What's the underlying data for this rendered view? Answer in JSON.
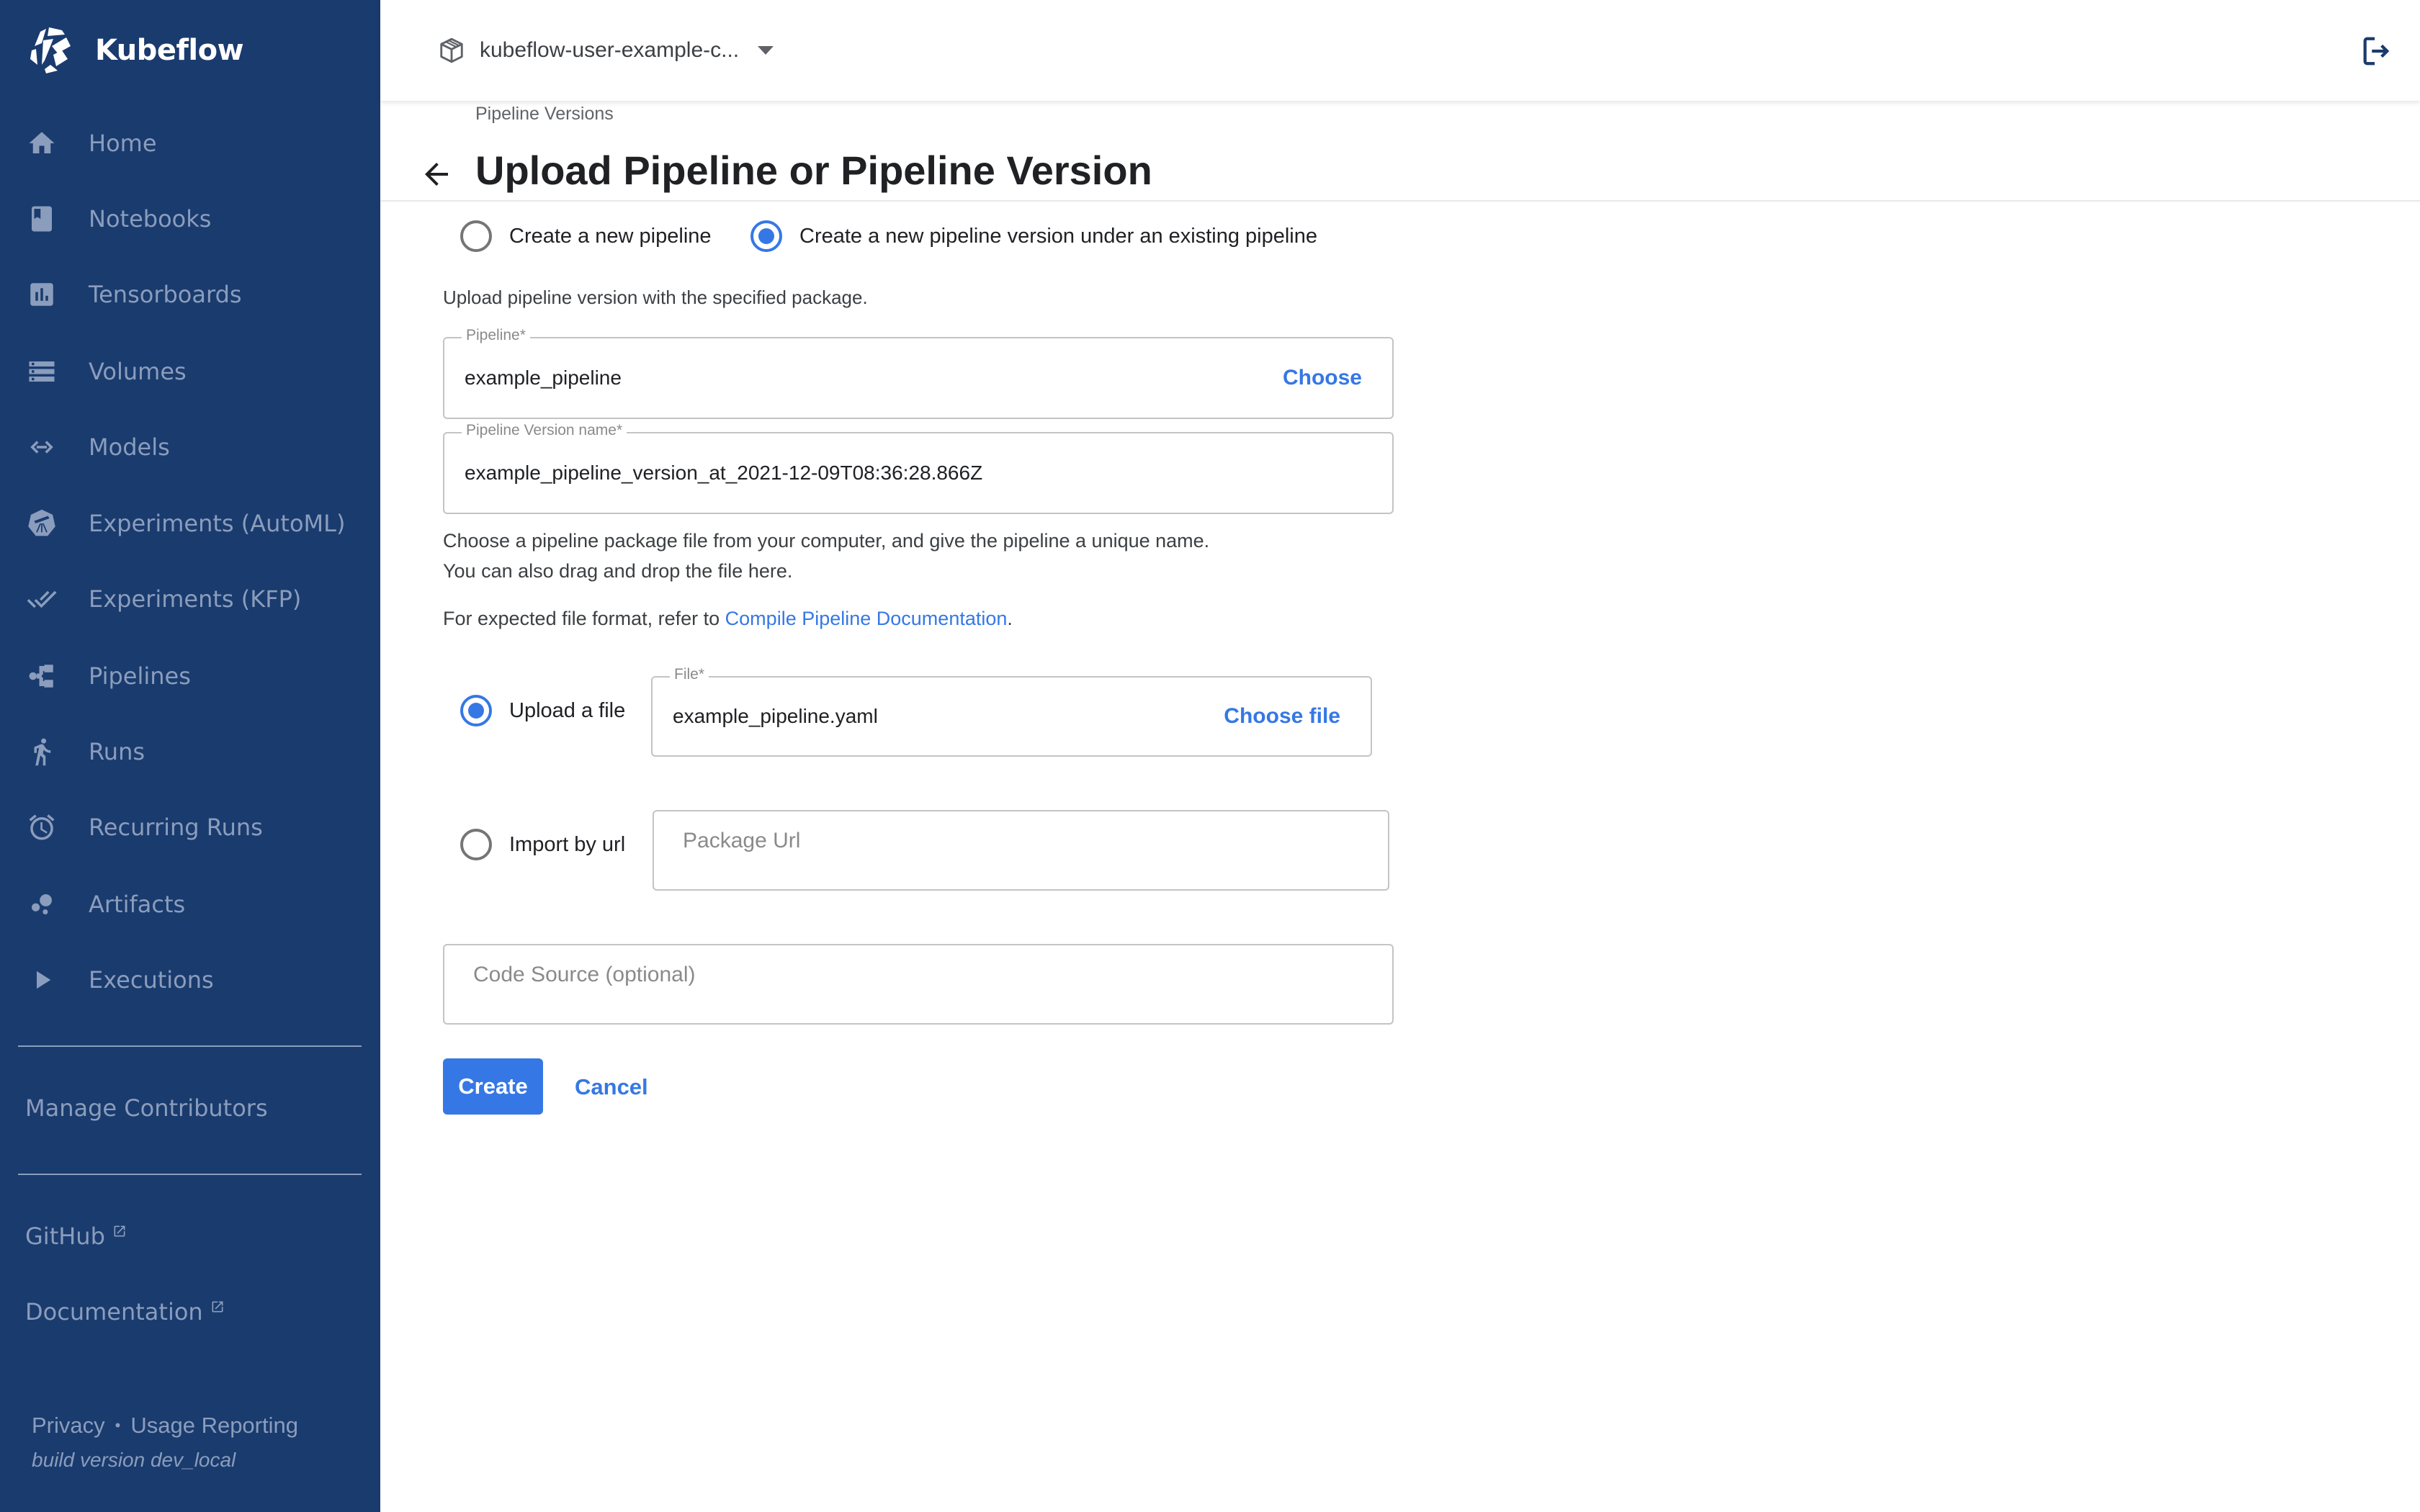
{
  "app": {
    "name": "Kubeflow"
  },
  "colors": {
    "sidebar_bg": "#1a3b6e",
    "sidebar_text": "#8b9dbc",
    "accent": "#3578e5"
  },
  "sidebar": {
    "items": [
      {
        "label": "Home",
        "icon": "home-icon"
      },
      {
        "label": "Notebooks",
        "icon": "notebook-icon"
      },
      {
        "label": "Tensorboards",
        "icon": "bar-chart-icon"
      },
      {
        "label": "Volumes",
        "icon": "storage-icon"
      },
      {
        "label": "Models",
        "icon": "code-arrows-icon"
      },
      {
        "label": "Experiments (AutoML)",
        "icon": "telescope-icon"
      },
      {
        "label": "Experiments (KFP)",
        "icon": "double-check-icon"
      },
      {
        "label": "Pipelines",
        "icon": "pipeline-icon"
      },
      {
        "label": "Runs",
        "icon": "running-person-icon"
      },
      {
        "label": "Recurring Runs",
        "icon": "alarm-clock-icon"
      },
      {
        "label": "Artifacts",
        "icon": "bubbles-icon"
      },
      {
        "label": "Executions",
        "icon": "play-icon"
      }
    ],
    "manage_contributors": "Manage Contributors",
    "external_links": [
      {
        "label": "GitHub",
        "icon": "external-link-icon"
      },
      {
        "label": "Documentation",
        "icon": "external-link-icon"
      }
    ],
    "footer": {
      "privacy": "Privacy",
      "separator": "•",
      "usage_reporting": "Usage Reporting",
      "build_version": "build version dev_local"
    }
  },
  "header": {
    "namespace": "kubeflow-user-example-c...",
    "namespace_icon": "cube-icon",
    "logout_icon": "logout-icon"
  },
  "page": {
    "breadcrumb": "Pipeline Versions",
    "title": "Upload Pipeline or Pipeline Version",
    "mode_options": [
      {
        "label": "Create a new pipeline",
        "checked": false
      },
      {
        "label": "Create a new pipeline version under an existing pipeline",
        "checked": true
      }
    ],
    "subtitle": "Upload pipeline version with the specified package.",
    "pipeline_field": {
      "label": "Pipeline*",
      "value": "example_pipeline",
      "action": "Choose"
    },
    "version_field": {
      "label": "Pipeline Version name*",
      "value": "example_pipeline_version_at_2021-12-09T08:36:28.866Z"
    },
    "instructions": {
      "line1": "Choose a pipeline package file from your computer, and give the pipeline a unique name.",
      "line2": "You can also drag and drop the file here.",
      "format_prefix": "For expected file format, refer to ",
      "format_link": "Compile Pipeline Documentation",
      "format_suffix": "."
    },
    "source_options": {
      "upload": {
        "label": "Upload a file",
        "checked": true
      },
      "url": {
        "label": "Import by url",
        "checked": false
      }
    },
    "file_field": {
      "label": "File*",
      "value": "example_pipeline.yaml",
      "action": "Choose file"
    },
    "url_field": {
      "placeholder": "Package Url"
    },
    "code_source_field": {
      "placeholder": "Code Source (optional)"
    },
    "buttons": {
      "create": "Create",
      "cancel": "Cancel"
    }
  }
}
